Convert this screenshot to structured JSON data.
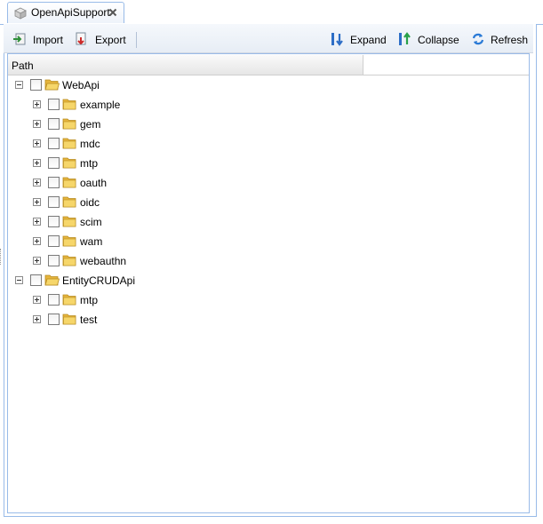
{
  "tab": {
    "title": "OpenApiSupport",
    "icon": "cube-icon",
    "close_icon": "close-icon"
  },
  "toolbar": {
    "import_label": "Import",
    "export_label": "Export",
    "expand_label": "Expand",
    "collapse_label": "Collapse",
    "refresh_label": "Refresh"
  },
  "grid": {
    "column_header": "Path"
  },
  "tree": {
    "webapi": {
      "label": "WebApi",
      "expanded": true,
      "children": [
        "example",
        "gem",
        "mdc",
        "mtp",
        "oauth",
        "oidc",
        "scim",
        "wam",
        "webauthn"
      ]
    },
    "entitycrudapi": {
      "label": "EntityCRUDApi",
      "expanded": true,
      "children": [
        "mtp",
        "test"
      ]
    }
  },
  "colors": {
    "border": "#99bbe8",
    "folder": "#f2c94c",
    "toolbar_bg": "#e7edf5"
  }
}
